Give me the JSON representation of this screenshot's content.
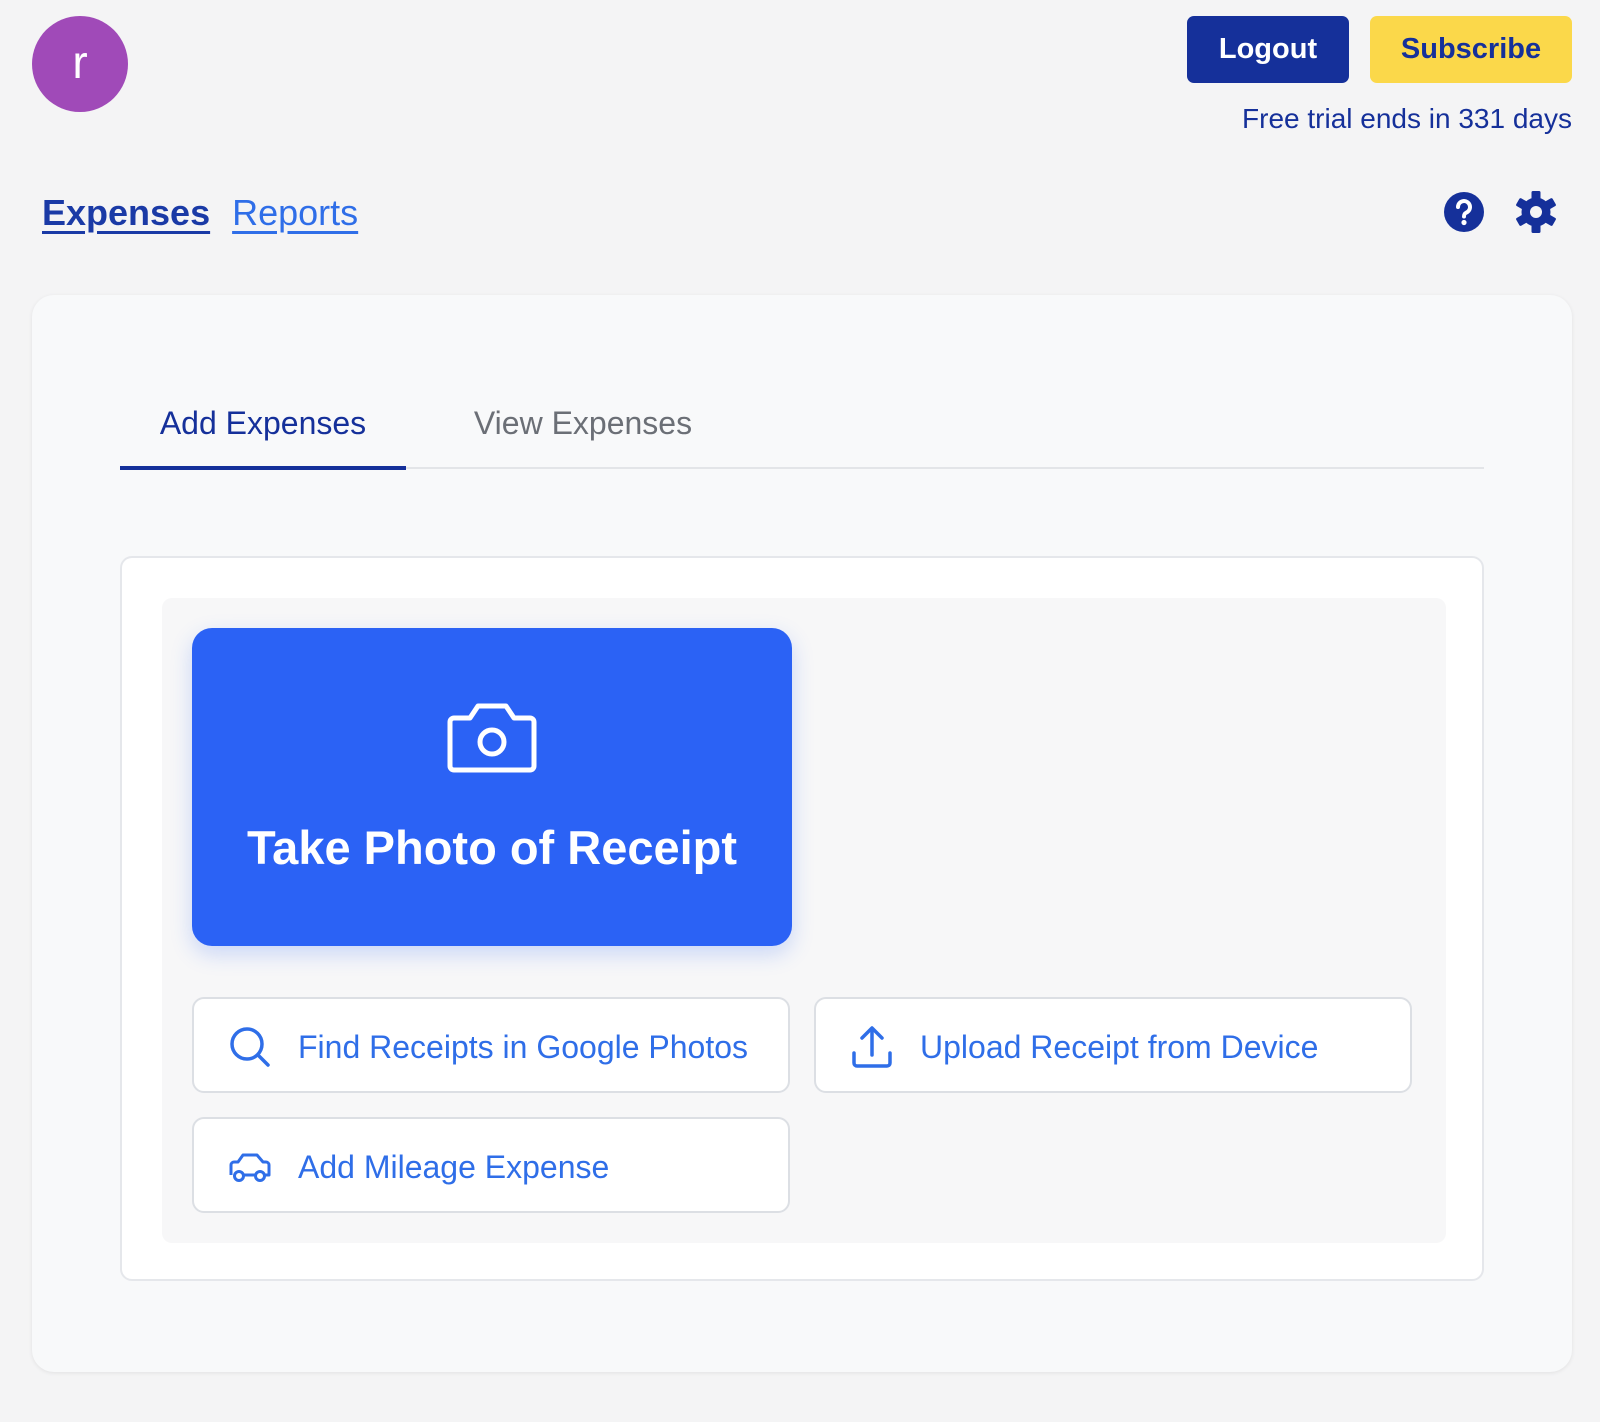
{
  "user": {
    "avatar_initial": "r",
    "avatar_color": "#a04ab8"
  },
  "header": {
    "logout_label": "Logout",
    "subscribe_label": "Subscribe",
    "trial_text": "Free trial ends in 331 days"
  },
  "nav": {
    "items": [
      {
        "label": "Expenses",
        "active": true
      },
      {
        "label": "Reports",
        "active": false
      }
    ],
    "icons": [
      "help-icon",
      "gear-icon"
    ]
  },
  "tabs": [
    {
      "label": "Add Expenses",
      "active": true
    },
    {
      "label": "View Expenses",
      "active": false
    }
  ],
  "add_expenses": {
    "primary_action": {
      "label": "Take Photo of Receipt",
      "icon": "camera-icon"
    },
    "options": [
      {
        "label": "Find Receipts in Google Photos",
        "icon": "search-icon"
      },
      {
        "label": "Upload Receipt from Device",
        "icon": "upload-icon"
      },
      {
        "label": "Add Mileage Expense",
        "icon": "car-icon"
      }
    ]
  },
  "colors": {
    "brand_dark": "#15309a",
    "accent_yellow": "#fbd84a",
    "primary_blue": "#2b62f5",
    "link_blue": "#2f6ee8"
  }
}
